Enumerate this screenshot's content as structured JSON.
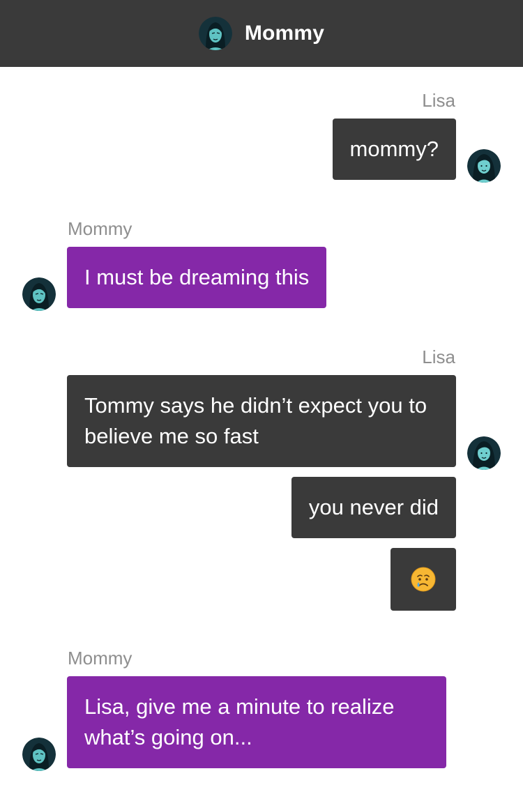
{
  "header": {
    "title": "Mommy",
    "avatar_icon": "mommy-avatar-icon"
  },
  "colors": {
    "header_bg": "#3a3a3a",
    "lisa_bubble": "#3a3a3a",
    "mommy_bubble": "#8528a8",
    "sender_label": "#8e8e8e"
  },
  "messages": [
    {
      "sender": "Lisa",
      "text": "mommy?"
    },
    {
      "sender": "Mommy",
      "text": "I must be dreaming this"
    },
    {
      "sender": "Lisa",
      "text": "Tommy says he didn’t expect you to believe me so fast"
    },
    {
      "sender": "Lisa",
      "text": "you never did"
    },
    {
      "sender": "Lisa",
      "text": "",
      "icon": "crying-face-emoji"
    },
    {
      "sender": "Mommy",
      "text": "Lisa, give me a minute to realize what’s going on..."
    }
  ],
  "groups": [
    {
      "label": "Lisa"
    },
    {
      "label": "Mommy"
    },
    {
      "label": "Lisa"
    },
    {
      "label": "Mommy"
    }
  ]
}
